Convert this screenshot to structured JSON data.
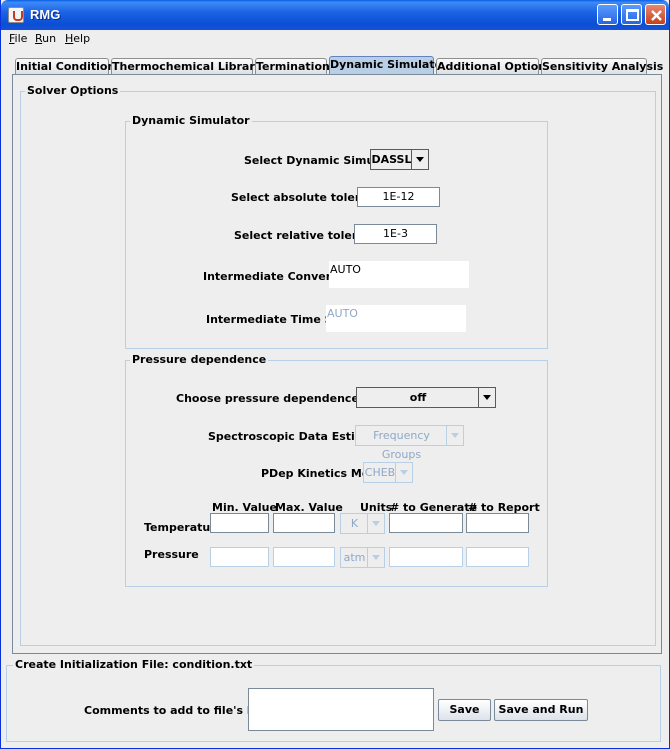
{
  "window": {
    "title": "RMG"
  },
  "menu": [
    "File",
    "Run",
    "Help"
  ],
  "tabs": [
    "Initial Conditions",
    "Thermochemical Libraries",
    "Termination",
    "Dynamic Simulator",
    "Additional Options",
    "Sensitivity Analysis"
  ],
  "active_tab": "Dynamic Simulator",
  "solver_options": {
    "legend": "Solver Options"
  },
  "dynamic_simulator": {
    "legend": "Dynamic Simulator",
    "select_label": "Select Dynamic Simulator",
    "select_value": "DASSL",
    "abs_tol_label": "Select absolute tolerance",
    "abs_tol_value": "1E-12",
    "rel_tol_label": "Select relative tolerance",
    "rel_tol_value": "1E-3",
    "int_conv_label": "Intermediate Conversions",
    "int_conv_value": "AUTO",
    "int_steps_label": "Intermediate Time Steps",
    "int_steps_value": "AUTO"
  },
  "pressure_dependence": {
    "legend": "Pressure dependence",
    "model_label": "Choose pressure dependence model",
    "model_value": "off",
    "spectro_label": "Spectroscopic Data Estimator",
    "spectro_value": "Frequency Groups",
    "kinetics_label": "PDep Kinetics Model",
    "kinetics_value": "CHEB",
    "grid_headers": {
      "min": "Min. Value",
      "max": "Max. Value",
      "units": "Units",
      "generate": "# to Generate",
      "report": "# to Report"
    },
    "temperature": {
      "label": "Temperature",
      "units": "K",
      "min": "",
      "max": "",
      "generate": "",
      "report": ""
    },
    "pressure": {
      "label": "Pressure",
      "units": "atm",
      "min": "",
      "max": "",
      "generate": "",
      "report": ""
    }
  },
  "init_file": {
    "legend": "Create Initialization File: condition.txt",
    "comments_label": "Comments to add to file's header:",
    "comments_value": "",
    "save_label": "Save",
    "save_run_label": "Save and Run"
  }
}
